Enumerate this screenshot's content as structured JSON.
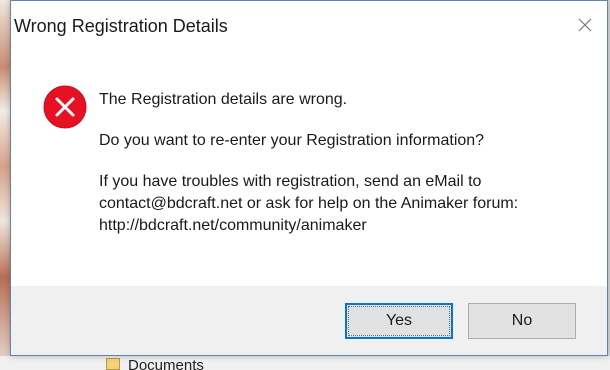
{
  "background": {
    "documents_label": "Documents"
  },
  "dialog": {
    "title": "Wrong Registration Details",
    "close_icon": "close-icon",
    "icon": "error-icon",
    "message": {
      "line1": "The Registration details are wrong.",
      "line2": "Do you want to re-enter your Registration information?",
      "line3a": "If you have troubles with registration, send an eMail to",
      "line3b": "contact@bdcraft.net or ask for help on the Animaker forum:",
      "line3c": "http://bdcraft.net/community/animaker"
    },
    "buttons": {
      "yes": "Yes",
      "no": "No"
    }
  },
  "colors": {
    "error_red": "#e81123",
    "focus_blue": "#0078d7",
    "footer_bg": "#f0f0f0"
  }
}
